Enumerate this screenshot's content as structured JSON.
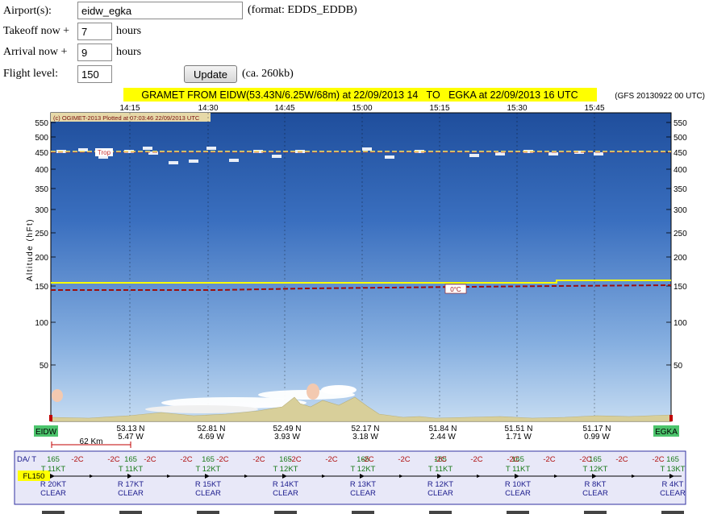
{
  "form": {
    "airports_label": "Airport(s):",
    "airports_value": "eidw_egka",
    "airports_hint": "(format: EDDS_EDDB)",
    "takeoff_label": "Takeoff now +",
    "takeoff_value": "7",
    "takeoff_unit": "hours",
    "arrival_label": "Arrival now +",
    "arrival_value": "9",
    "arrival_unit": "hours",
    "flight_level_label": "Flight level:",
    "flight_level_value": "150",
    "update_button": "Update",
    "size_hint": "(ca. 260kb)"
  },
  "gramet": {
    "title": "GRAMET FROM EIDW(53.43N/6.25W/68m) at 22/09/2013 14   TO   EGKA at 22/09/2013 16 UTC",
    "model": "(GFS 20130922 00 UTC)",
    "copyright": "(c) OGIMET-2013 Plotted at 07:03:46 22/09/2013 UTC",
    "y_axis_label": "Altitude (hFt)",
    "tropo_label": "Trop",
    "freezing_label": "0°C",
    "departure": "EIDW",
    "arrival": "EGKA",
    "scale_label": "62 Km",
    "time_ticks": [
      "14:15",
      "14:30",
      "14:45",
      "15:00",
      "15:15",
      "15:30",
      "15:45"
    ],
    "altitude_ticks": [
      550,
      500,
      450,
      400,
      350,
      300,
      250,
      200,
      150,
      100,
      50
    ],
    "route_points": [
      {
        "lat": "53.13 N",
        "lon": "5.47 W"
      },
      {
        "lat": "52.81 N",
        "lon": "4.69 W"
      },
      {
        "lat": "52.49 N",
        "lon": "3.93 W"
      },
      {
        "lat": "52.17 N",
        "lon": "3.18 W"
      },
      {
        "lat": "51.84 N",
        "lon": "2.44 W"
      },
      {
        "lat": "51.51 N",
        "lon": "1.71 W"
      },
      {
        "lat": "51.17 N",
        "lon": "0.99 W"
      }
    ],
    "colors": {
      "sky_top": "#1f4e9c",
      "sky_bottom": "#b8d4ef",
      "terrain": "#d8cf9a",
      "tropo": "#ffff66",
      "freezing": "#9b1010",
      "flight_level": "#ffff00",
      "station_box": "#4cc46c",
      "title_bg": "#ffff00"
    }
  },
  "info_panel": {
    "da_t_label": "DA/ T",
    "fl_label": "FL150",
    "da_values": [
      "165",
      "165",
      "165",
      "165",
      "165",
      "165",
      "165",
      "165",
      "165"
    ],
    "temp_values": [
      "-2C",
      "-2C",
      "-2C",
      "-2C",
      "-2C",
      "-2C",
      "-2C",
      "-2C",
      "-2C",
      "-2C",
      "-2C",
      "-2C",
      "-2C",
      "-2C",
      "-2C",
      "-2C",
      "-2C"
    ],
    "tail_winds": [
      "T 11KT",
      "T 11KT",
      "T 12KT",
      "T 12KT",
      "T 12KT",
      "T 11KT",
      "T 11KT",
      "T 12KT",
      "T 13KT"
    ],
    "cross_winds": [
      "R 20KT",
      "R 17KT",
      "R 15KT",
      "R 14KT",
      "R 13KT",
      "R 12KT",
      "R 10KT",
      "R 8KT",
      "R 4KT"
    ],
    "conditions": [
      "CLEAR",
      "CLEAR",
      "CLEAR",
      "CLEAR",
      "CLEAR",
      "CLEAR",
      "CLEAR",
      "CLEAR",
      "CLEAR"
    ]
  }
}
